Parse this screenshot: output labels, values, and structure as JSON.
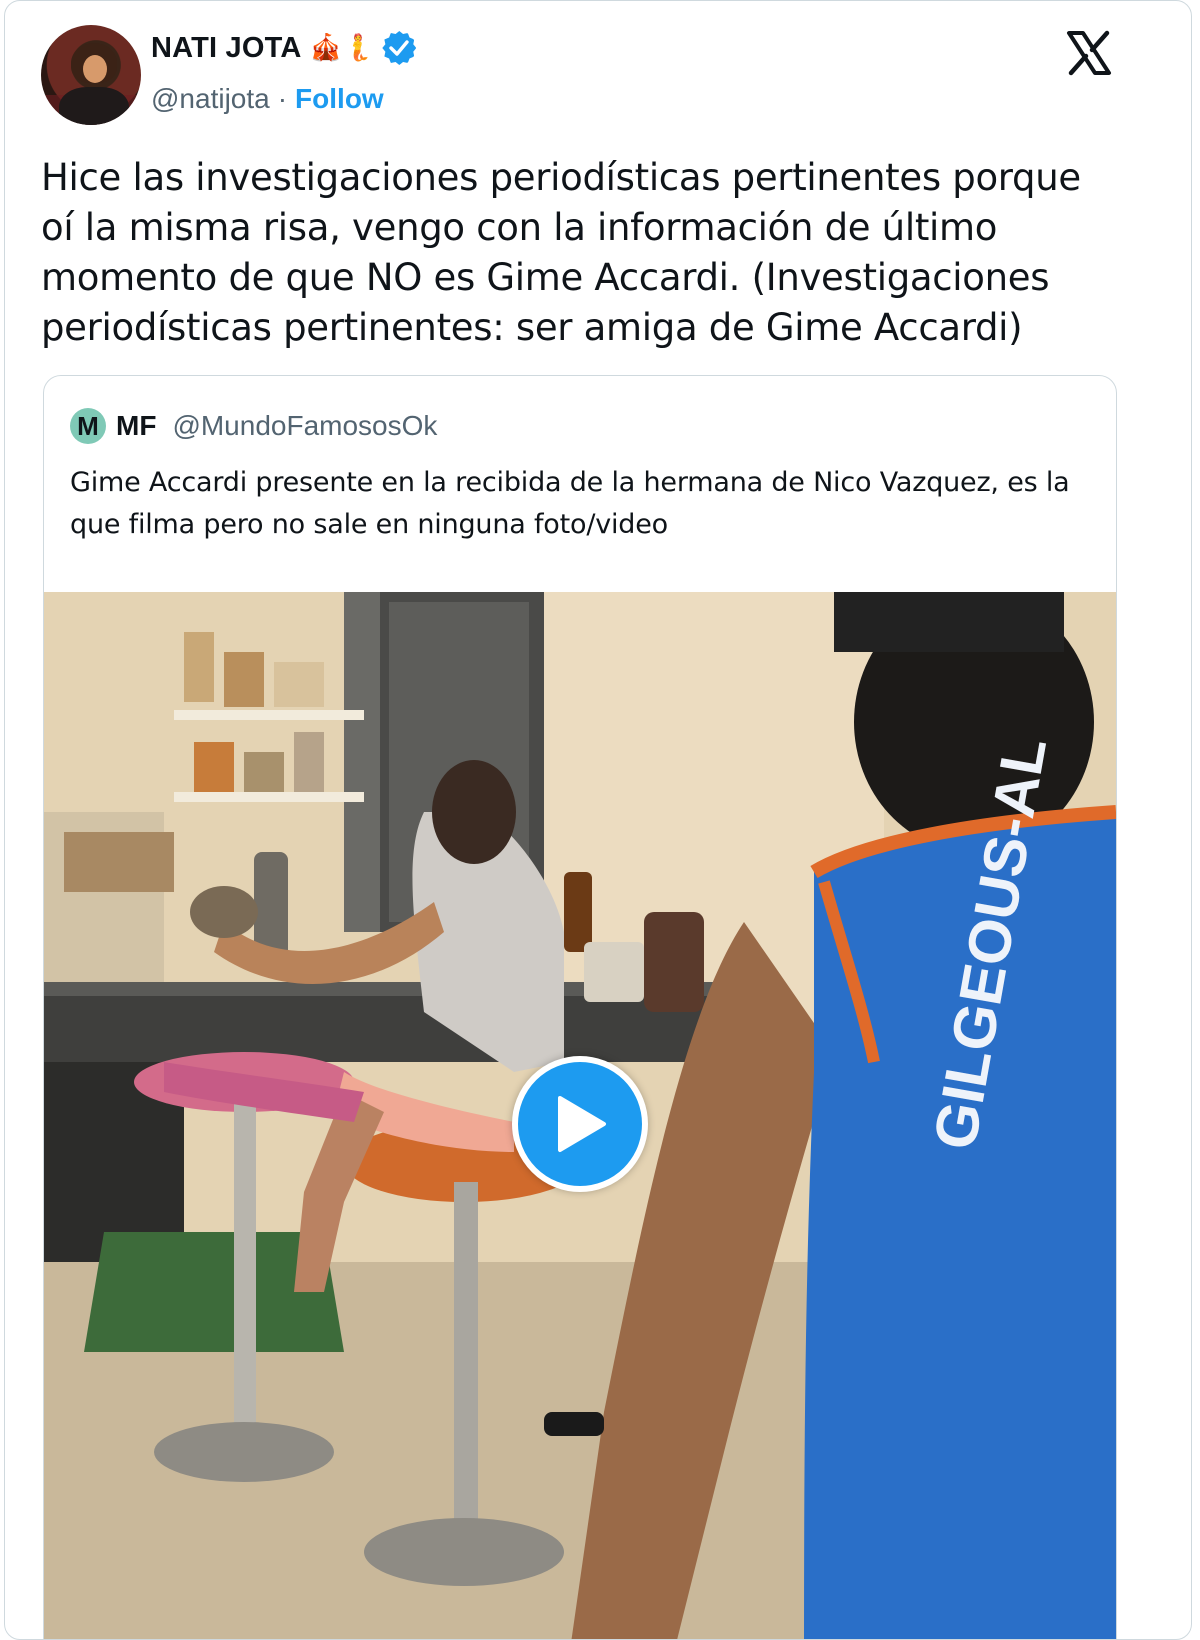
{
  "author": {
    "name": "NATI JOTA",
    "emojis": "🎪🧜",
    "handle": "@natijota",
    "separator": "·",
    "follow_label": "Follow",
    "verified_color": "#1d9bf0"
  },
  "tweet": {
    "text": "Hice las investigaciones periodísticas pertinentes porque oí la misma risa, vengo con la información de último momento de que NO es Gime Accardi. (Investigaciones periodísticas pertinentes: ser amiga de Gime Accardi)"
  },
  "quoted": {
    "avatar_letter": "M",
    "name": "MF",
    "handle": "@MundoFamososOk",
    "text": "Gime Accardi presente en la recibida de la hermana de Nico Vazquez, es la que filma pero no sale en ninguna foto/video"
  },
  "media": {
    "jersey_text": "GILGEOUS-AL",
    "play_icon": "play-icon"
  },
  "icons": {
    "brand": "x-logo-icon",
    "verified": "verified-badge-icon"
  }
}
